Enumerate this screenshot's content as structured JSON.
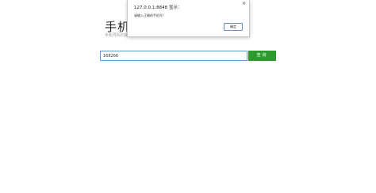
{
  "page": {
    "title": "手机",
    "subtitle": "手机号码归属"
  },
  "search": {
    "value": "168266",
    "button_label": "查询"
  },
  "alert": {
    "origin": "127.0.0.1:8848 显示：",
    "message": "请输入正确的手机号！",
    "ok_label": "确定",
    "close_glyph": "×"
  },
  "colors": {
    "button_green": "#2d9a2d",
    "input_border": "#5b9bd5"
  }
}
